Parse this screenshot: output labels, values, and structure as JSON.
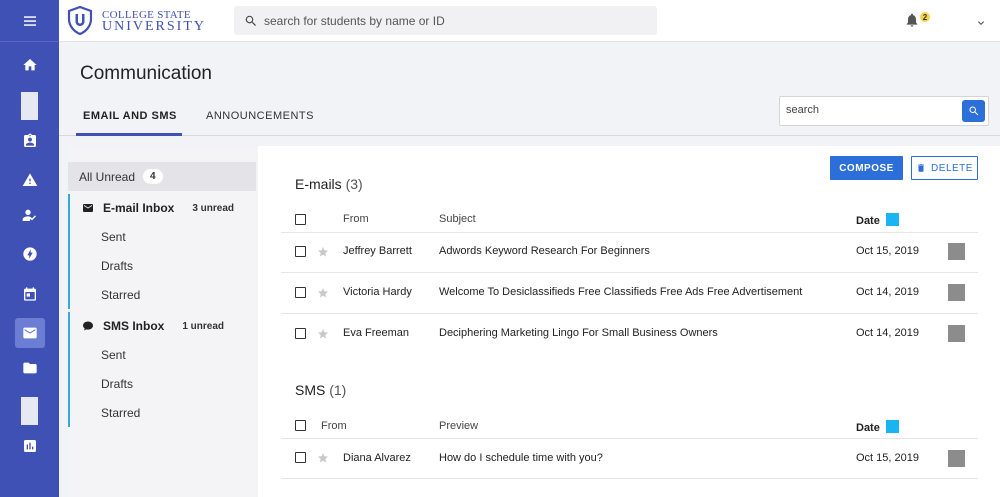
{
  "brand": {
    "line1": "COLLEGE STATE",
    "line2": "UNIVERSITY",
    "color": "#3f51b5"
  },
  "topbar": {
    "search_placeholder": "search for students by name or ID",
    "notifications_count": "2"
  },
  "nav_icons": [
    "menu-icon",
    "home-icon",
    "clipboard-icon",
    "warning-icon",
    "user-check-icon",
    "bolt-icon",
    "calendar-icon",
    "mail-icon",
    "folder-icon",
    "chart-icon"
  ],
  "page": {
    "title": "Communication",
    "tabs": [
      {
        "label": "EMAIL AND SMS",
        "active": true
      },
      {
        "label": "ANNOUNCEMENTS",
        "active": false
      }
    ],
    "search_placeholder": "search"
  },
  "folders": {
    "all_unread": {
      "label": "All Unread",
      "count": "4"
    },
    "email": {
      "label": "E-mail Inbox",
      "unread": "3 unread",
      "items": [
        "Sent",
        "Drafts",
        "Starred"
      ]
    },
    "sms": {
      "label": "SMS Inbox",
      "unread": "1 unread",
      "items": [
        "Sent",
        "Drafts",
        "Starred"
      ]
    }
  },
  "actions": {
    "compose": "COMPOSE",
    "delete": "DELETE"
  },
  "emails": {
    "title": "E-mails",
    "count": "(3)",
    "headers": {
      "from": "From",
      "subject": "Subject",
      "date": "Date"
    },
    "rows": [
      {
        "from": "Jeffrey Barrett",
        "subject": "Adwords Keyword Research For Beginners",
        "date": "Oct 15, 2019"
      },
      {
        "from": "Victoria Hardy",
        "subject": "Welcome To Desiclassifieds Free Classifieds Free Ads Free Advertisement",
        "date": "Oct 14, 2019"
      },
      {
        "from": "Eva Freeman",
        "subject": "Deciphering Marketing Lingo For Small Business Owners",
        "date": "Oct 14, 2019"
      }
    ]
  },
  "sms": {
    "title": "SMS",
    "count": "(1)",
    "headers": {
      "from": "From",
      "preview": "Preview",
      "date": "Date"
    },
    "rows": [
      {
        "from": "Diana Alvarez",
        "preview": "How do I schedule time with you?",
        "date": "Oct 15, 2019"
      }
    ]
  },
  "colors": {
    "accent": "#2d6fd8",
    "nav": "#3f51b5",
    "date_marker": "#19b5f2",
    "folder_border": "#33aadf"
  }
}
